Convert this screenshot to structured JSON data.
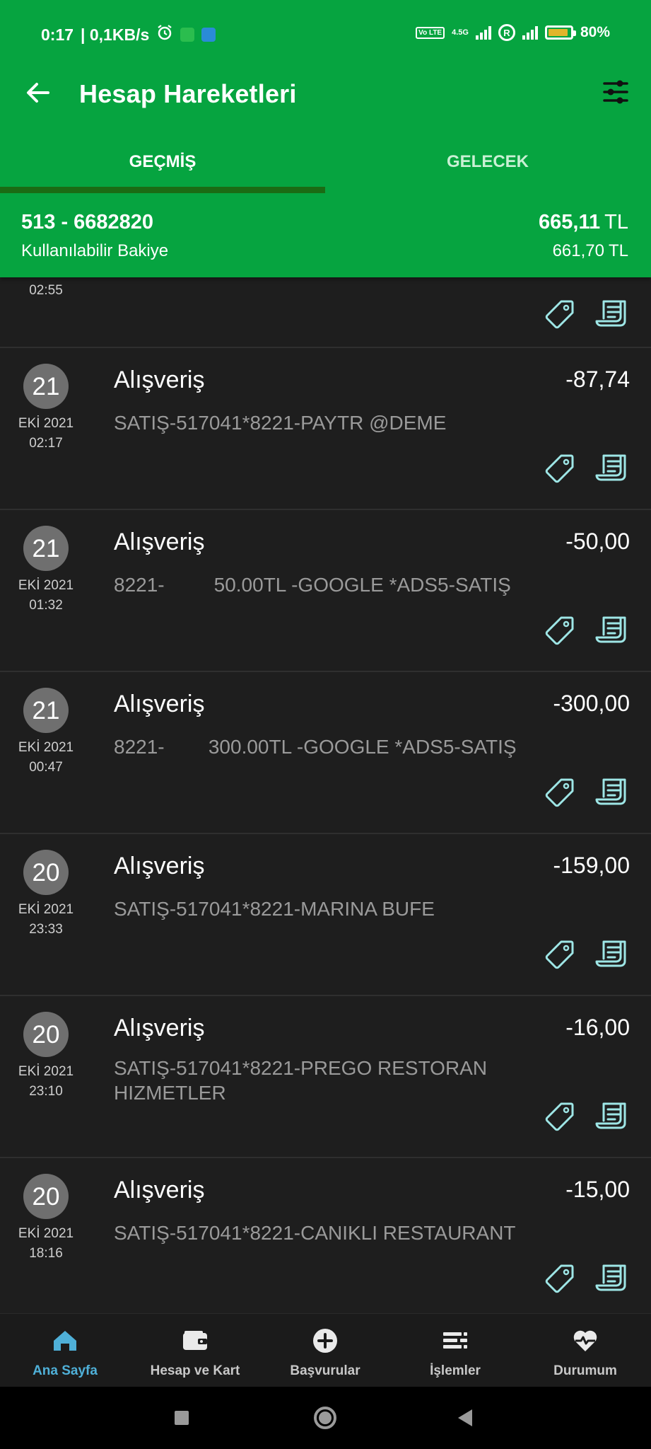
{
  "status_bar": {
    "time": "0:17",
    "speed": "| 0,1KB/s",
    "network": "4.5G",
    "volte": "Vo LTE",
    "roaming": "R",
    "battery": "80%"
  },
  "toolbar": {
    "title": "Hesap Hareketleri",
    "back_icon": "arrow-left-icon",
    "filter_icon": "sliders-icon"
  },
  "tabs": [
    {
      "label": "GEÇMİŞ",
      "active": true
    },
    {
      "label": "GELECEK",
      "active": false
    }
  ],
  "account": {
    "number": "513 - 6682820",
    "label": "Kullanılabilir Bakiye",
    "balance": "665,11",
    "available": "661,70",
    "currency": "TL"
  },
  "transactions": [
    {
      "partial": true,
      "time": "02:55"
    },
    {
      "day": "21",
      "month": "EKİ 2021",
      "time": "02:17",
      "title": "Alışveriş",
      "amount": "-87,74",
      "desc": "SATIŞ-517041*8221-PAYTR @DEME"
    },
    {
      "day": "21",
      "month": "EKİ 2021",
      "time": "01:32",
      "title": "Alışveriş",
      "amount": "-50,00",
      "desc": "8221-         50.00TL -GOOGLE *ADS5-SATIŞ"
    },
    {
      "day": "21",
      "month": "EKİ 2021",
      "time": "00:47",
      "title": "Alışveriş",
      "amount": "-300,00",
      "desc": "8221-        300.00TL -GOOGLE *ADS5-SATIŞ"
    },
    {
      "day": "20",
      "month": "EKİ 2021",
      "time": "23:33",
      "title": "Alışveriş",
      "amount": "-159,00",
      "desc": "SATIŞ-517041*8221-MARINA BUFE"
    },
    {
      "day": "20",
      "month": "EKİ 2021",
      "time": "23:10",
      "title": "Alışveriş",
      "amount": "-16,00",
      "desc": "SATIŞ-517041*8221-PREGO RESTORAN HIZMETLER"
    },
    {
      "day": "20",
      "month": "EKİ 2021",
      "time": "18:16",
      "title": "Alışveriş",
      "amount": "-15,00",
      "desc": "SATIŞ-517041*8221-CANIKLI RESTAURANT"
    }
  ],
  "bottom_nav": [
    {
      "label": "Ana Sayfa",
      "icon": "home-icon",
      "active": true
    },
    {
      "label": "Hesap ve Kart",
      "icon": "wallet-icon",
      "active": false
    },
    {
      "label": "Başvurular",
      "icon": "plus-circle-icon",
      "active": false
    },
    {
      "label": "İşlemler",
      "icon": "list-icon",
      "active": false
    },
    {
      "label": "Durumum",
      "icon": "heart-pulse-icon",
      "active": false
    }
  ],
  "colors": {
    "brand_green": "#06a440",
    "tab_indicator": "#1b6b14",
    "accent_cyan": "#9ee6e6",
    "nav_active": "#4fb0d8"
  }
}
